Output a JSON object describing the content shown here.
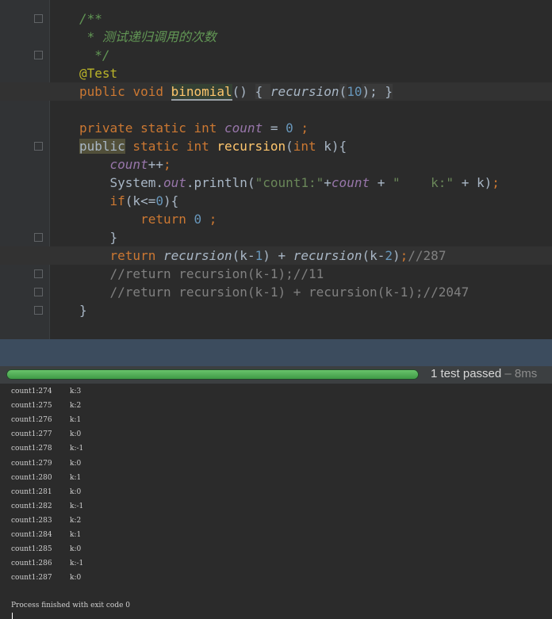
{
  "editor": {
    "gutter_fold_marker": "+",
    "lines": [
      {
        "parts": [
          [
            "doc",
            "/**"
          ]
        ]
      },
      {
        "parts": [
          [
            "doc",
            " * 测试递归调用的次数"
          ]
        ]
      },
      {
        "parts": [
          [
            "doc",
            "  */"
          ]
        ]
      },
      {
        "parts": [
          [
            "ann",
            "@Test"
          ]
        ]
      },
      {
        "parts": [
          [
            "kw",
            "public "
          ],
          [
            "kw",
            "void "
          ],
          [
            "selhl",
            "binomial"
          ],
          [
            "p",
            "() "
          ],
          [
            "fold-region",
            "{ "
          ],
          [
            "it",
            "recursion"
          ],
          [
            "fold-region",
            "("
          ],
          [
            "num",
            "10"
          ],
          [
            "fold-region",
            "); }"
          ]
        ]
      },
      {
        "parts": []
      },
      {
        "parts": [
          [
            "kw",
            "private "
          ],
          [
            "kw",
            "static "
          ],
          [
            "kw",
            "int "
          ],
          [
            "fi",
            "count"
          ],
          [
            "p",
            " = "
          ],
          [
            "num",
            "0"
          ],
          [
            "kw",
            " ;"
          ]
        ]
      },
      {
        "parts": [
          [
            "pubhl",
            "public"
          ],
          [
            "kw",
            " static "
          ],
          [
            "kw",
            "int "
          ],
          [
            "fn",
            "recursion"
          ],
          [
            "p",
            "("
          ],
          [
            "kw",
            "int "
          ],
          [
            "p",
            "k){"
          ]
        ]
      },
      {
        "parts": [
          [
            "p",
            "    "
          ],
          [
            "fi",
            "count"
          ],
          [
            "p",
            "++"
          ],
          [
            "kw",
            ";"
          ]
        ]
      },
      {
        "parts": [
          [
            "p",
            "    System."
          ],
          [
            "fi",
            "out"
          ],
          [
            "p",
            ".println("
          ],
          [
            "str",
            "\"count1:\""
          ],
          [
            "p",
            "+"
          ],
          [
            "fi",
            "count"
          ],
          [
            "p",
            " + "
          ],
          [
            "str",
            "\"    k:\""
          ],
          [
            "p",
            " + k)"
          ],
          [
            "kw",
            ";"
          ]
        ]
      },
      {
        "parts": [
          [
            "p",
            "    "
          ],
          [
            "kw",
            "if"
          ],
          [
            "p",
            "(k<="
          ],
          [
            "num",
            "0"
          ],
          [
            "p",
            "){"
          ]
        ]
      },
      {
        "parts": [
          [
            "p",
            "        "
          ],
          [
            "kw",
            "return "
          ],
          [
            "num",
            "0"
          ],
          [
            "kw",
            " ;"
          ]
        ]
      },
      {
        "parts": [
          [
            "p",
            "    }"
          ]
        ]
      },
      {
        "parts": [
          [
            "p",
            "    "
          ],
          [
            "kw",
            "return "
          ],
          [
            "it",
            "recursion"
          ],
          [
            "p",
            "(k-"
          ],
          [
            "num",
            "1"
          ],
          [
            "p",
            ") + "
          ],
          [
            "it",
            "recursion"
          ],
          [
            "p",
            "(k-"
          ],
          [
            "num",
            "2"
          ],
          [
            "p",
            ")"
          ],
          [
            "kw",
            ";"
          ],
          [
            "cmt",
            "//287"
          ]
        ]
      },
      {
        "parts": [
          [
            "cmt",
            "    //return recursion(k-1);//11"
          ]
        ]
      },
      {
        "parts": [
          [
            "cmt",
            "    //return recursion(k-1) + recursion(k-1);//2047"
          ]
        ]
      },
      {
        "parts": [
          [
            "p",
            "}"
          ]
        ]
      }
    ]
  },
  "test_runner": {
    "progress_fraction": 1.0,
    "status_text": "1 test passed",
    "time_text": " – 8ms"
  },
  "console": {
    "rows": [
      [
        "count1:274",
        "k:3"
      ],
      [
        "count1:275",
        "k:2"
      ],
      [
        "count1:276",
        "k:1"
      ],
      [
        "count1:277",
        "k:0"
      ],
      [
        "count1:278",
        "k:-1"
      ],
      [
        "count1:279",
        "k:0"
      ],
      [
        "count1:280",
        "k:1"
      ],
      [
        "count1:281",
        "k:0"
      ],
      [
        "count1:282",
        "k:-1"
      ],
      [
        "count1:283",
        "k:2"
      ],
      [
        "count1:284",
        "k:1"
      ],
      [
        "count1:285",
        "k:0"
      ],
      [
        "count1:286",
        "k:-1"
      ],
      [
        "count1:287",
        "k:0"
      ]
    ],
    "exit_message": "Process finished with exit code 0"
  },
  "colors": {
    "keyword": "#cc7832",
    "field": "#9876aa",
    "number": "#6897bb",
    "string": "#6a8759",
    "comment": "#808080",
    "javadoc": "#629755",
    "annotation": "#bbb529",
    "method_decl": "#ffc66d",
    "test_pass_green": "#59a869"
  },
  "icons": {
    "run_test": "run-test-icon",
    "recursive_call": "recursive-call-icon"
  }
}
